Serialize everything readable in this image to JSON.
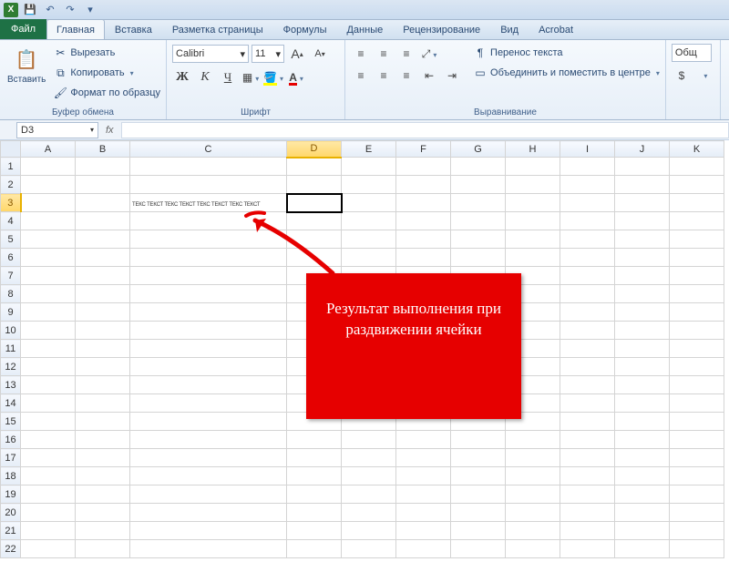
{
  "quick_access": {
    "save_tip": "Сохранить",
    "undo_tip": "Отменить",
    "redo_tip": "Повторить"
  },
  "tabs": {
    "file": "Файл",
    "home": "Главная",
    "insert": "Вставка",
    "page_layout": "Разметка страницы",
    "formulas": "Формулы",
    "data": "Данные",
    "review": "Рецензирование",
    "view": "Вид",
    "acrobat": "Acrobat"
  },
  "ribbon": {
    "clipboard": {
      "paste": "Вставить",
      "cut": "Вырезать",
      "copy": "Копировать",
      "format_painter": "Формат по образцу",
      "group_label": "Буфер обмена"
    },
    "font": {
      "name": "Calibri",
      "size": "11",
      "increase": "A",
      "decrease": "A",
      "bold": "Ж",
      "italic": "К",
      "underline": "Ч",
      "group_label": "Шрифт"
    },
    "alignment": {
      "wrap_text": "Перенос текста",
      "merge": "Объединить и поместить в центре",
      "group_label": "Выравнивание"
    },
    "number": {
      "general": "Общ",
      "currency": "$"
    }
  },
  "name_box": "D3",
  "columns": [
    "A",
    "B",
    "C",
    "D",
    "E",
    "F",
    "G",
    "H",
    "I",
    "J",
    "K"
  ],
  "rows": [
    "1",
    "2",
    "3",
    "4",
    "5",
    "6",
    "7",
    "8",
    "9",
    "10",
    "11",
    "12",
    "13",
    "14",
    "15",
    "16",
    "17",
    "18",
    "19",
    "20",
    "21",
    "22"
  ],
  "selected_col": "D",
  "selected_row": "3",
  "cells": {
    "C3": "текс текст текс текст текс текст текс текст"
  },
  "annotation": {
    "text": "Результат выполнения при раздвижении ячейки"
  }
}
